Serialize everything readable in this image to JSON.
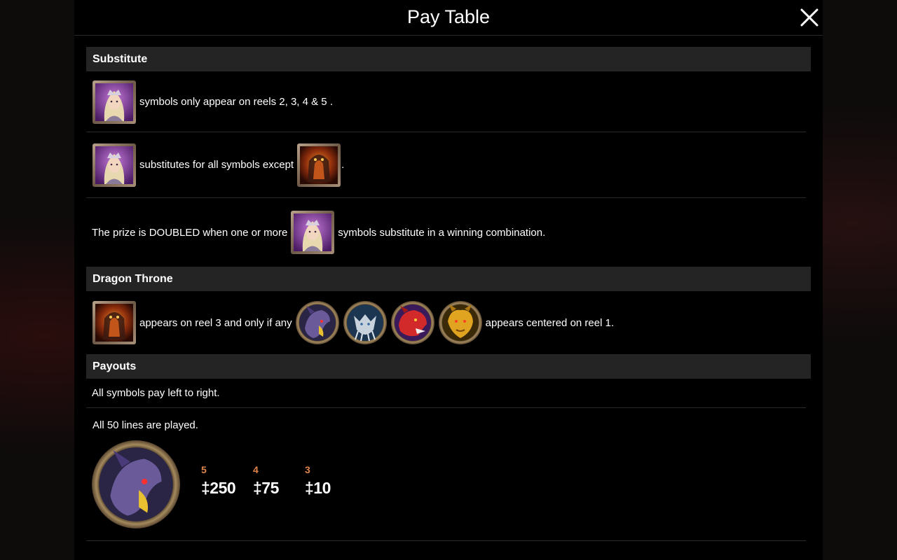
{
  "header": {
    "title": "Pay Table"
  },
  "sections": {
    "substitute": "Substitute",
    "dragon_throne": "Dragon Throne",
    "payouts": "Payouts"
  },
  "substitute": {
    "row1_text": "symbols only appear on reels 2, 3, 4 & 5 .",
    "row2_text": "substitutes for all symbols except",
    "row2_end": ".",
    "row3_pre": "The prize is DOUBLED when one or more",
    "row3_post": "symbols substitute in a winning combination."
  },
  "dragon_throne": {
    "pre": "appears on reel 3 and only if any",
    "post": "appears centered on reel 1."
  },
  "payouts": {
    "line1": "All symbols pay left to right.",
    "line2": "All 50 lines are played.",
    "table": [
      {
        "count": "5",
        "value": "‡250"
      },
      {
        "count": "4",
        "value": "‡75"
      },
      {
        "count": "3",
        "value": "‡10"
      }
    ]
  },
  "icons": {
    "wild": "queen-wild-icon",
    "scatter": "dragon-throne-icon",
    "dragons": [
      "purple-dragon-icon",
      "silver-dragon-icon",
      "red-dragon-icon",
      "gold-dragon-icon"
    ]
  },
  "colors": {
    "section_bg": "#242424",
    "pay_count": "#e0844a",
    "panel_bg": "#000000"
  }
}
